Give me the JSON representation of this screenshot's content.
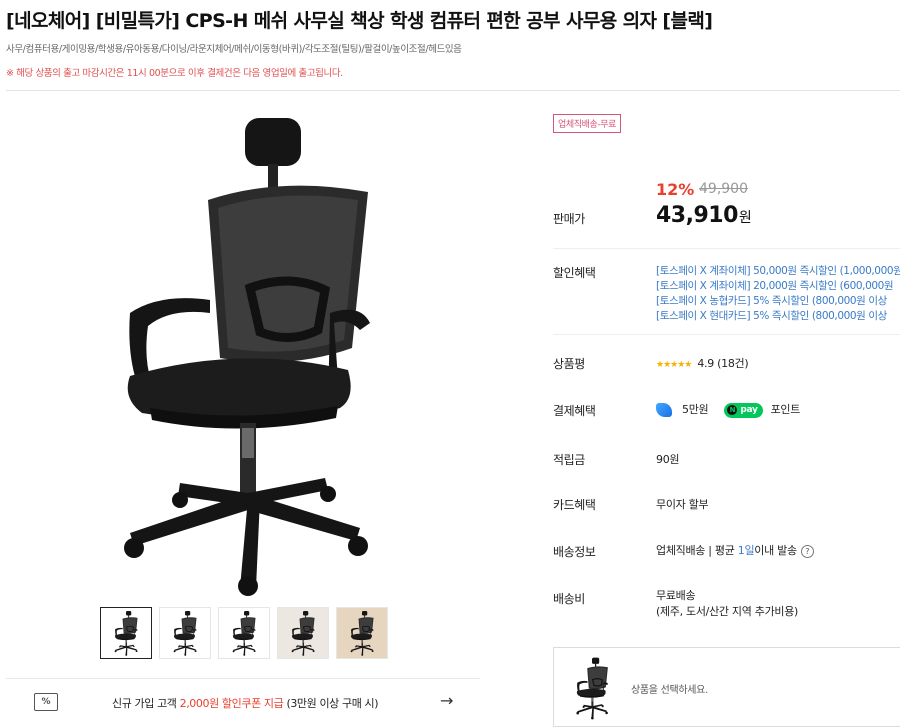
{
  "product": {
    "title": "[네오체어] [비밀특가] CPS-H 메쉬 사무실 책상 학생 컴퓨터 편한 공부 사무용 의자 [블랙]",
    "tags": "사무/컴퓨터용/게이밍용/학생용/유아동용/다이닝/라운지체어/메쉬/이동형(바퀴)/각도조절(틸팅)/팔걸이/높이조절/헤드있음",
    "notice": "※ 해당 상품의 출고 마감시간은 11시 00분으로 이후 결제건은 다음 영업일에 출고됩니다."
  },
  "badge": "업체직배송-무료",
  "price": {
    "label": "판매가",
    "discount": "12%",
    "original": "49,900",
    "sale": "43,910",
    "unit": "원"
  },
  "discount_benefits": {
    "label": "할인혜택",
    "items": [
      "[토스페이 X 계좌이체] 50,000원 즉시할인 (1,000,000원",
      "[토스페이 X 계좌이체] 20,000원 즉시할인 (600,000원",
      "[토스페이 X 농협카드] 5% 즉시할인 (800,000원 이상",
      "[토스페이 X 현대카드] 5% 즉시할인 (800,000원 이상"
    ]
  },
  "review": {
    "label": "상품평",
    "stars": "★★★★★",
    "rating": 4.9,
    "rating_text": "4.9",
    "count_text": "(18건)"
  },
  "payment": {
    "label": "결제혜택",
    "toss_amount": "5만원",
    "npay_label": "pay",
    "point_text": "포인트"
  },
  "points": {
    "label": "적립금",
    "value": "90원"
  },
  "card": {
    "label": "카드혜택",
    "value": "무이자 할부"
  },
  "shipping_info": {
    "label": "배송정보",
    "prefix": "업체직배송 | 평균 ",
    "days": "1일",
    "suffix": "이내 발송"
  },
  "shipping_fee": {
    "label": "배송비",
    "line1": "무료배송",
    "line2": "(제주, 도서/산간 지역 추가비용)"
  },
  "coupon": {
    "icon_text": "%",
    "before": "신규 가입 고객 ",
    "highlight": "2,000원 할인쿠폰 지급",
    "after": " (3만원 이상 구매 시)",
    "arrow": "→"
  },
  "option_select": {
    "placeholder": "상품을 선택하세요."
  },
  "colors": {
    "accent_red": "#e8402f",
    "benefit_blue": "#3a7bc8",
    "badge_pink": "#d8557a",
    "npay_green": "#03c75a"
  }
}
